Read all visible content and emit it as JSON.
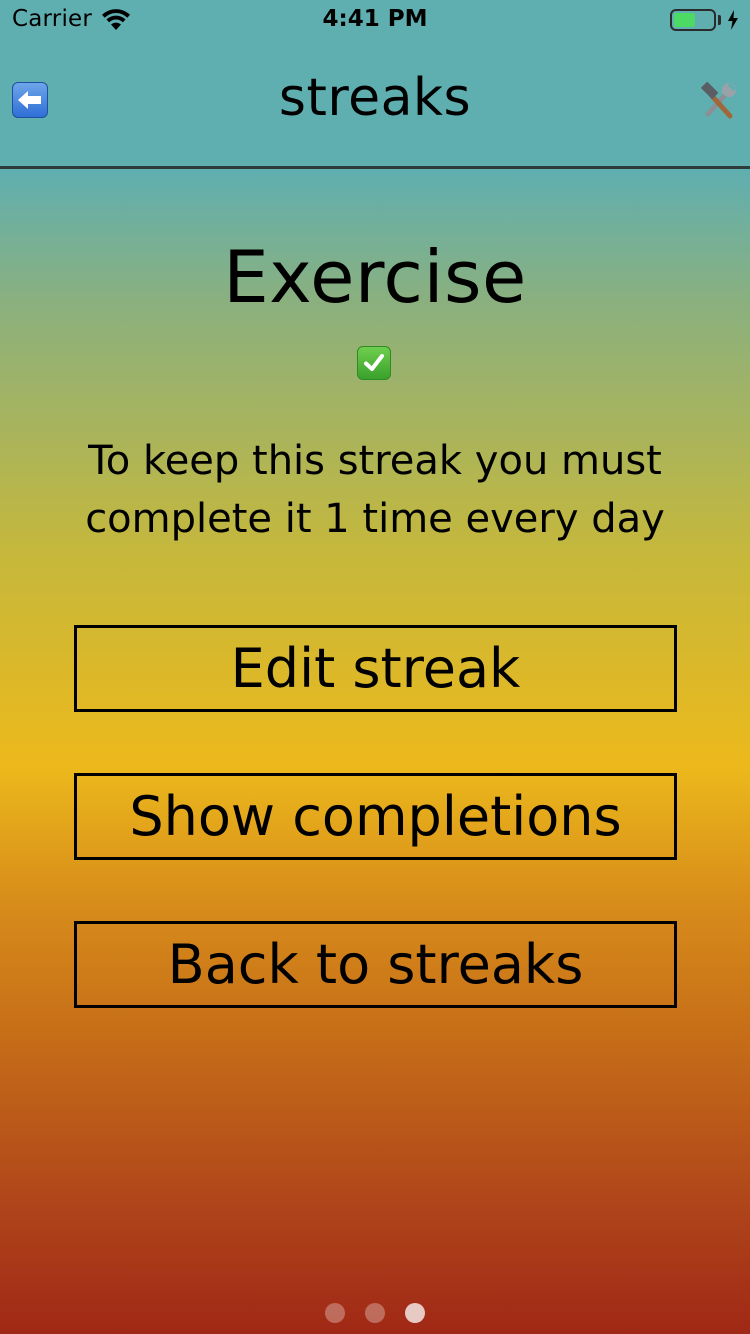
{
  "status_bar": {
    "carrier": "Carrier",
    "time": "4:41 PM",
    "battery_level": 0.55,
    "battery_color": "#4cd964",
    "icons": [
      "wifi-icon",
      "battery-icon",
      "charging-bolt-icon"
    ]
  },
  "nav": {
    "title": "streaks",
    "left_icon": "back-arrow-icon",
    "right_icon": "hammer-wrench-icon"
  },
  "streak": {
    "name": "Exercise",
    "status_icon": "checkmark-icon",
    "description": "To keep this streak you must complete it 1 time every day"
  },
  "buttons": {
    "edit": "Edit streak",
    "completions": "Show completions",
    "back": "Back to streaks"
  },
  "page_control": {
    "total": 3,
    "current": 3
  },
  "colors": {
    "top": "#5fafb1",
    "middle": "#ecb91c",
    "bottom": "#a02816"
  }
}
